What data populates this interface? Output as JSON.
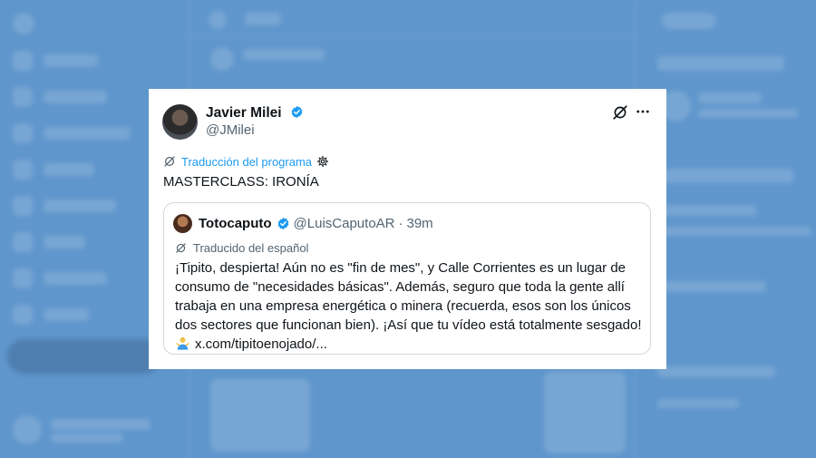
{
  "colors": {
    "page_background": "#5f96cc",
    "card_background": "#ffffff",
    "accent_blue": "#1d9bf0",
    "muted_text": "#536471",
    "border": "#cfd9de"
  },
  "tweet": {
    "author_name": "Javier Milei",
    "author_handle": "@JMilei",
    "verified_icon": "verified-badge-icon",
    "translation_label": "Traducción del programa",
    "text": "MASTERCLASS: IRONÍA"
  },
  "quote": {
    "author_name": "Totocaputo",
    "author_handle": "@LuisCaputoAR",
    "separator": "·",
    "time": "39m",
    "translation_label": "Traducido del español",
    "lines": [
      "¡Tipito, despierta! Aún no es \"fin de mes\", y Calle Corrientes es un lugar de",
      "consumo de \"necesidades básicas\". Además, seguro que toda la gente allí",
      "trabaja en una empresa energética o minera (recuerda, esos son los únicos",
      "dos sectores que funcionan bien). ¡Así que tu vídeo está totalmente sesgado!"
    ],
    "link_text": "x.com/tipitoenojado/...",
    "emoji_icon": "person-shrugging-icon"
  }
}
